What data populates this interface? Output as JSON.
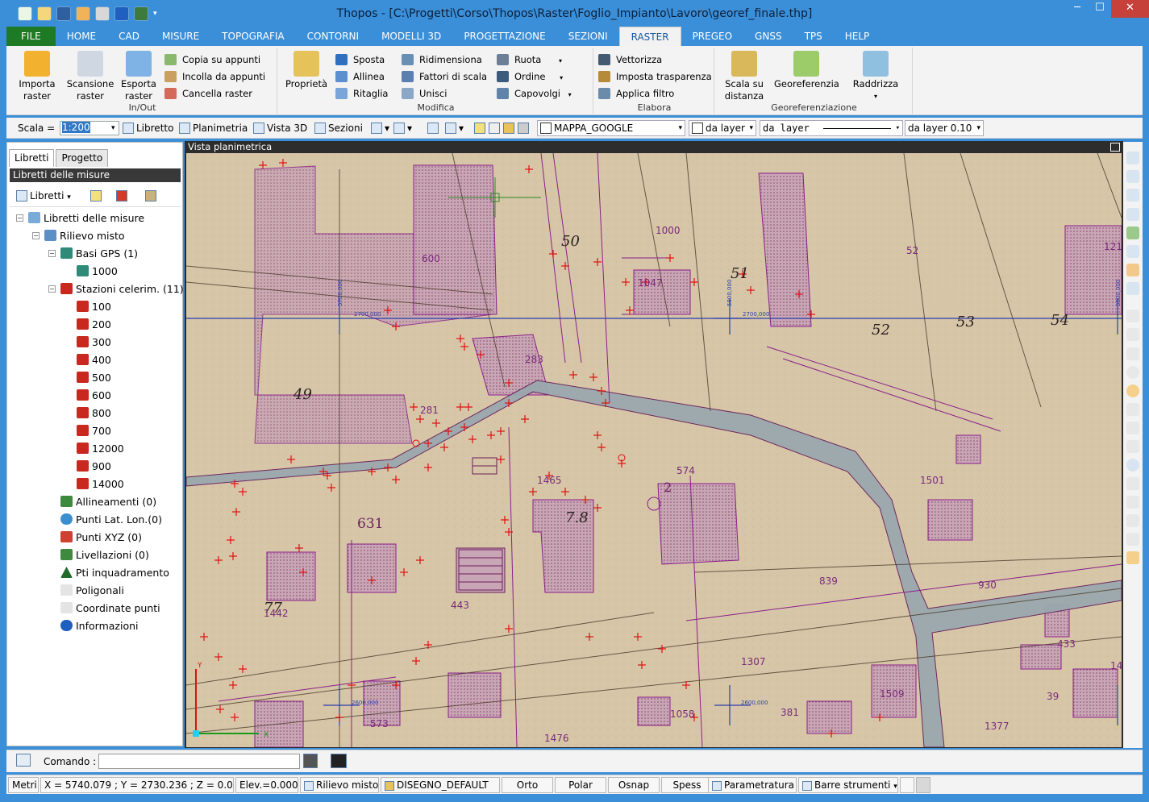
{
  "window": {
    "title": "Thopos - [C:\\Progetti\\Corso\\Thopos\\Raster\\Foglio_Impianto\\Lavoro\\georef_finale.thp]",
    "controls": {
      "minimize": "─",
      "maximize": "☐",
      "close": "✕"
    }
  },
  "ribbon_tabs": [
    "FILE",
    "HOME",
    "CAD",
    "MISURE",
    "TOPOGRAFIA",
    "CONTORNI",
    "MODELLI 3D",
    "PROGETTAZIONE",
    "SEZIONI",
    "RASTER",
    "PREGEO",
    "GNSS",
    "TPS",
    "HELP"
  ],
  "ribbon": {
    "inout": {
      "label": "In/Out",
      "importa": "Importa raster",
      "scansione": "Scansione raster",
      "esporta": "Esporta raster",
      "copia": "Copia su appunti",
      "incolla": "Incolla da appunti",
      "cancella": "Cancella raster"
    },
    "modifica": {
      "label": "Modifica",
      "proprieta": "Proprietà",
      "sposta": "Sposta",
      "allinea": "Allinea",
      "ritaglia": "Ritaglia",
      "ridimensiona": "Ridimensiona",
      "fattori": "Fattori di scala",
      "unisci": "Unisci",
      "ruota": "Ruota",
      "ordine": "Ordine",
      "capovolgi": "Capovolgi"
    },
    "elabora": {
      "label": "Elabora",
      "vettorizza": "Vettorizza",
      "trasparenza": "Imposta trasparenza",
      "filtro": "Applica filtro"
    },
    "georef": {
      "label": "Georeferenziazione",
      "scala": "Scala su distanza",
      "georeferenzia": "Georeferenzia",
      "raddrizza": "Raddrizza"
    }
  },
  "toolbar": {
    "scala_label": "Scala =",
    "scala_value": "1:200",
    "libretto": "Libretto",
    "planimetria": "Planimetria",
    "vista3d": "Vista 3D",
    "sezioni": "Sezioni",
    "layer": "MAPPA_GOOGLE",
    "color_by": "da layer",
    "linetype_by": "da layer",
    "lineweight": "da layer 0.10"
  },
  "left_panel": {
    "tabs": [
      "Libretti",
      "Progetto"
    ],
    "header": "Libretti delle misure",
    "tool_libretti": "Libretti",
    "tree": {
      "root": "Libretti delle misure",
      "rilievo": "Rilievo misto",
      "basi": "Basi GPS (1)",
      "base_1000": "1000",
      "stazioni": "Stazioni celerim. (11)",
      "stazioni_items": [
        "100",
        "200",
        "300",
        "400",
        "500",
        "600",
        "800",
        "700",
        "12000",
        "900",
        "14000"
      ],
      "allineamenti": "Allineamenti (0)",
      "punti_lat": "Punti Lat. Lon.(0)",
      "punti_xyz": "Punti XYZ (0)",
      "livellazioni": "Livellazioni (0)",
      "inquadramento": "Pti inquadramento",
      "poligonali": "Poligonali",
      "coordinate": "Coordinate punti",
      "informazioni": "Informazioni"
    }
  },
  "map": {
    "title": "Vista planimetrica",
    "parcel_labels": [
      "50",
      "51",
      "52",
      "53",
      "54",
      "49",
      "7.8",
      "631",
      "77",
      "2",
      "600",
      "1000",
      "1047",
      "52",
      "1501",
      "574",
      "1465",
      "283",
      "281",
      "839",
      "930",
      "443",
      "1442",
      "1307",
      "1058",
      "381",
      "1509",
      "39",
      "573",
      "1476",
      "1377",
      "433",
      "121",
      "14"
    ],
    "coord_labels": [
      "2700,000",
      "2700,000",
      "2600,000",
      "2600,000",
      "5700,000",
      "5800,000",
      "5900,000"
    ],
    "axis_labels": {
      "x": "X",
      "y": "Y"
    }
  },
  "command": {
    "label": "Comando :",
    "value": ""
  },
  "status": {
    "units": "Metri",
    "coords": "X = 5740.079 ; Y = 2730.236 ; Z = 0.000",
    "elev": "Elev.=0.000",
    "libretto": "Rilievo misto",
    "layer": "DISEGNO_DEFAULT",
    "orto": "Orto",
    "polar": "Polar",
    "osnap": "Osnap",
    "spess": "Spess",
    "parametratura": "Parametratura",
    "barre": "Barre strumenti"
  },
  "colors": {
    "title_bar": "#3b8fd8",
    "file_tab": "#1e7a24",
    "parcel_fill": "#c9a6b5",
    "parcel_line": "#8a1f8a",
    "road": "#9aa8ad",
    "point_cross": "#e01010",
    "paper": "#d6c6a7"
  }
}
